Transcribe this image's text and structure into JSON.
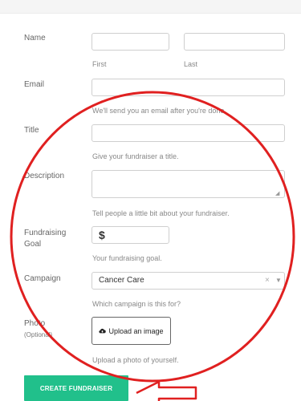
{
  "form": {
    "name_label": "Name",
    "first_hint": "First",
    "last_hint": "Last",
    "email_label": "Email",
    "email_hint": "We'll send you an email after you're done.",
    "title_label": "Title",
    "title_hint": "Give your fundraiser a title.",
    "description_label": "Description",
    "description_hint": "Tell people a little bit about your fundraiser.",
    "goal_label_line1": "Fundraising",
    "goal_label_line2": "Goal",
    "currency_symbol": "$",
    "goal_hint": "Your fundraising goal.",
    "campaign_label": "Campaign",
    "campaign_selected": "Cancer Care",
    "campaign_clear": "×",
    "campaign_hint": "Which campaign is this for?",
    "photo_label": "Photo",
    "photo_optional": "(Optional)",
    "upload_label": "Upload an image",
    "photo_hint": "Upload a photo of yourself.",
    "submit_label": "CREATE FUNDRAISER"
  },
  "colors": {
    "accent": "#21c08b",
    "annotation": "#e02020"
  },
  "icons": {
    "upload": "cloud-upload-icon",
    "select_caret": "chevron-down-icon",
    "select_clear": "close-icon"
  }
}
